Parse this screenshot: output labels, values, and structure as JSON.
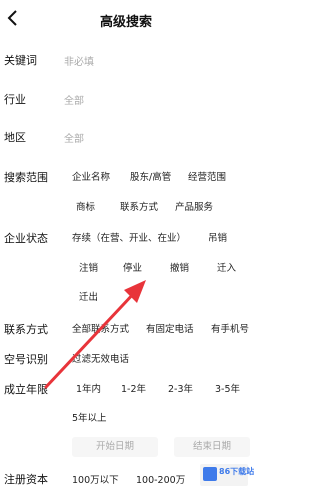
{
  "header": {
    "title": "高级搜索"
  },
  "rows": {
    "keyword": {
      "label": "关键词",
      "placeholder": "非必填"
    },
    "industry": {
      "label": "行业",
      "value": "全部"
    },
    "region": {
      "label": "地区",
      "value": "全部"
    },
    "scope": {
      "label": "搜索范围",
      "options": [
        "企业名称",
        "股东/高管",
        "经营范围",
        "商标",
        "联系方式",
        "产品服务"
      ]
    },
    "status": {
      "label": "企业状态",
      "options": [
        "存续（在营、开业、在业）",
        "吊销",
        "注销",
        "停业",
        "撤销",
        "迁入",
        "迁出"
      ]
    },
    "contact": {
      "label": "联系方式",
      "options": [
        "全部联系方式",
        "有固定电话",
        "有手机号"
      ]
    },
    "phone_check": {
      "label": "空号识别",
      "options": [
        "过滤无效电话"
      ]
    },
    "founded": {
      "label": "成立年限",
      "options": [
        "1年内",
        "1-2年",
        "2-3年",
        "3-5年",
        "5年以上"
      ],
      "start_placeholder": "开始日期",
      "end_placeholder": "结束日期"
    },
    "capital": {
      "label": "注册资本",
      "options": [
        "100万以下",
        "100-200万"
      ]
    }
  },
  "watermark": {
    "brand": "86下载站"
  },
  "colors": {
    "arrow": "#e8343a",
    "muted": "#aaaaaa",
    "text": "#222222"
  }
}
